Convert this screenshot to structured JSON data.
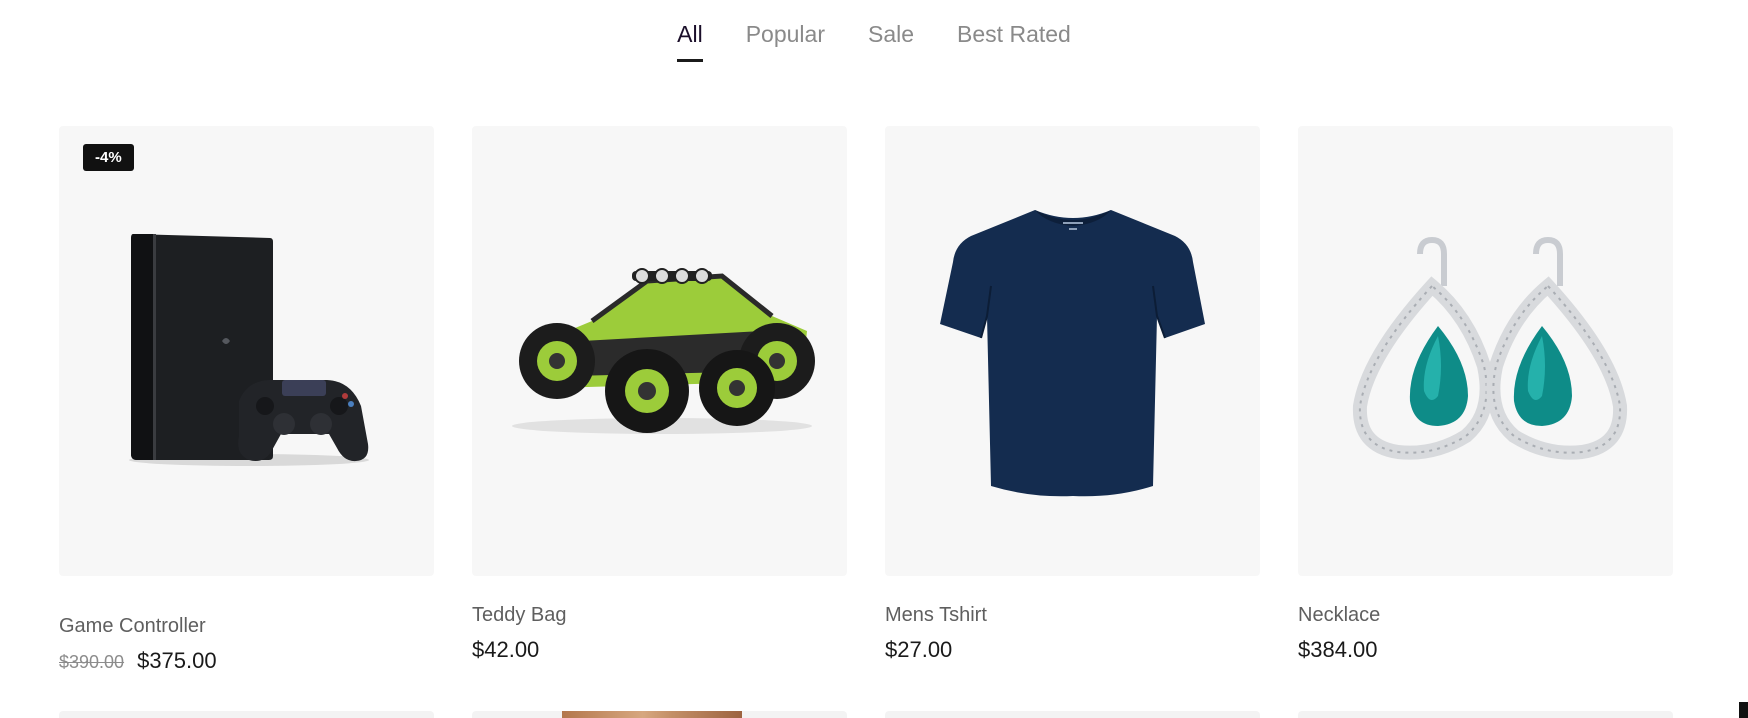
{
  "tabs": [
    {
      "label": "All",
      "active": true
    },
    {
      "label": "Popular",
      "active": false
    },
    {
      "label": "Sale",
      "active": false
    },
    {
      "label": "Best Rated",
      "active": false
    }
  ],
  "products": [
    {
      "title": "Game Controller",
      "old_price": "$390.00",
      "price": "$375.00",
      "badge": "-4%",
      "image_icon": "game-console-image"
    },
    {
      "title": "Teddy Bag",
      "price": "$42.00",
      "image_icon": "rc-car-image"
    },
    {
      "title": "Mens Tshirt",
      "price": "$27.00",
      "image_icon": "tshirt-image"
    },
    {
      "title": "Necklace",
      "price": "$384.00",
      "image_icon": "earrings-image"
    }
  ],
  "colors": {
    "tab_active": "#1b0f2a",
    "tab_inactive": "#8a8a8a",
    "card_bg": "#f7f7f7",
    "badge_bg": "#111111",
    "price": "#1a1a1a"
  }
}
